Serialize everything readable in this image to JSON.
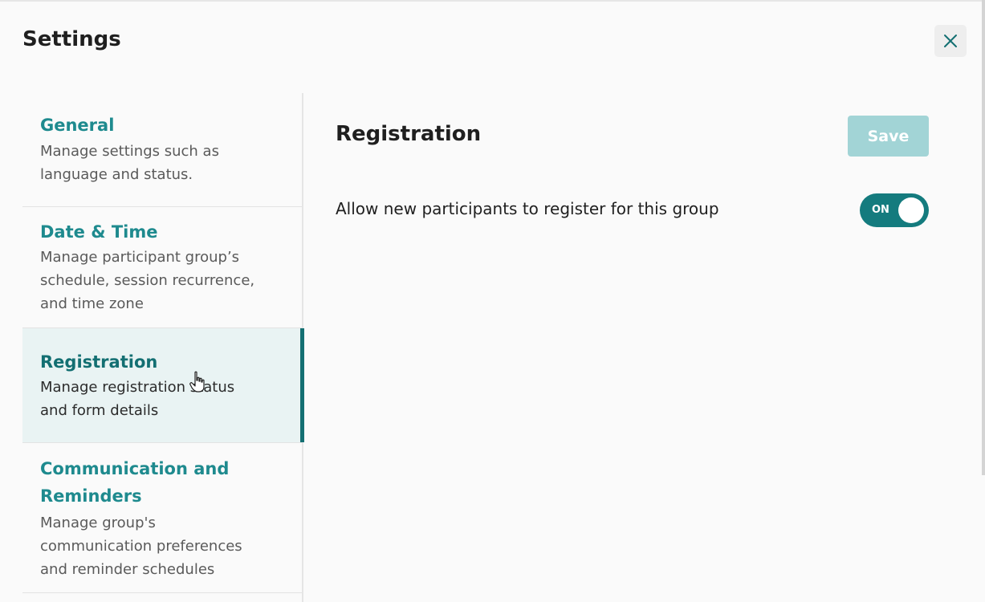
{
  "header": {
    "title": "Settings",
    "close_icon": "close-icon"
  },
  "sidebar": {
    "items": [
      {
        "title": "General",
        "description": [
          "Manage settings such as",
          "language and status."
        ],
        "active": false
      },
      {
        "title": "Date & Time",
        "description": [
          "Manage participant group’s",
          "schedule, session recurrence,",
          "and time zone"
        ],
        "active": false
      },
      {
        "title": "Registration",
        "description": [
          "Manage registration status",
          "and form details"
        ],
        "active": true
      },
      {
        "title": "Communication and",
        "title_line2": "Reminders",
        "description": [
          "Manage group's",
          "communication preferences",
          "and reminder schedules"
        ],
        "active": false
      }
    ]
  },
  "main": {
    "title": "Registration",
    "save_label": "Save",
    "setting_label": "Allow new participants to register for this group",
    "toggle": {
      "state_label": "ON",
      "enabled": true
    }
  },
  "colors": {
    "accent": "#136f72",
    "link": "#1e8a8e",
    "active_bg": "#e9f3f3",
    "save_disabled": "#a2d4d6"
  }
}
